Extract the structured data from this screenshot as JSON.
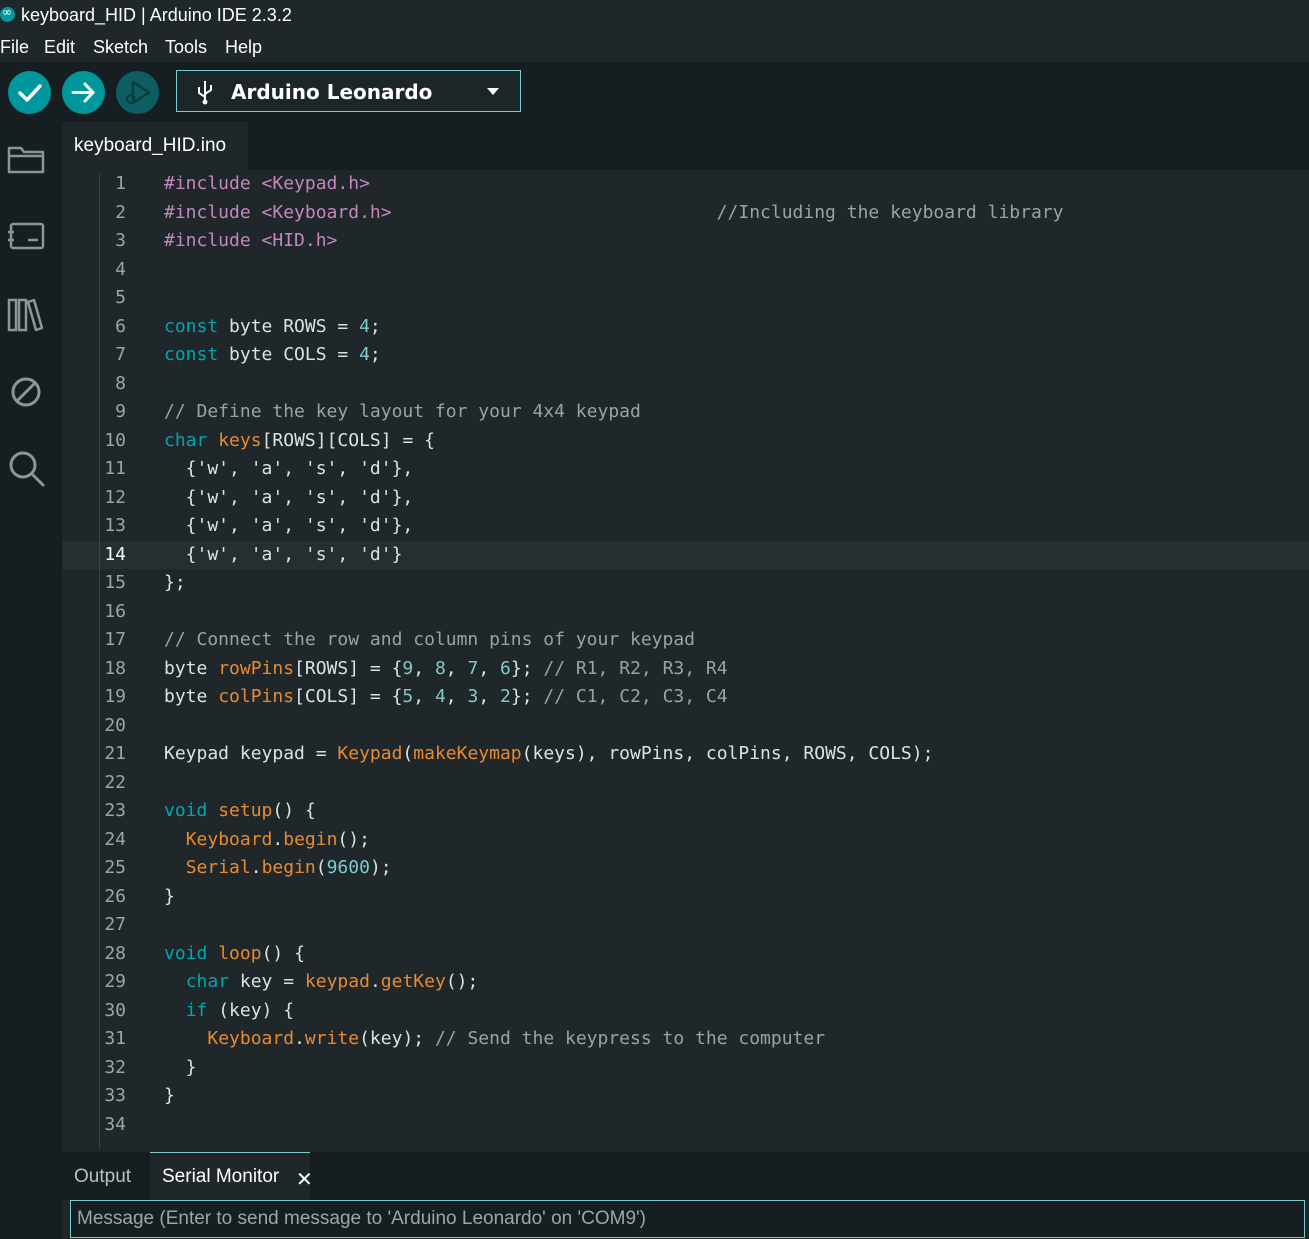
{
  "window": {
    "title": "keyboard_HID | Arduino IDE 2.3.2"
  },
  "menu": {
    "items": [
      "File",
      "Edit",
      "Sketch",
      "Tools",
      "Help"
    ]
  },
  "toolbar": {
    "board": "Arduino Leonardo"
  },
  "colors": {
    "accent": "#00979c",
    "keyword": "#00a7ad",
    "preprocessor": "#c586c0",
    "function": "#e98a31",
    "comment": "#95a5a6",
    "number": "#7fcbcd",
    "plain": "#dae3e3"
  },
  "sidebar": {
    "icons": [
      "folder-icon",
      "board-manager-icon",
      "library-icon",
      "debug-icon",
      "search-icon"
    ]
  },
  "editor": {
    "tab": "keyboard_HID.ino",
    "current_line": 14,
    "lines": [
      {
        "n": "1",
        "t": [
          [
            "pp",
            "#include <Keypad.h>"
          ]
        ]
      },
      {
        "n": "2",
        "t": [
          [
            "pp",
            "#include <Keyboard.h>"
          ],
          [
            "cm",
            "                              //Including the keyboard library"
          ]
        ]
      },
      {
        "n": "3",
        "t": [
          [
            "pp",
            "#include <HID.h>"
          ]
        ]
      },
      {
        "n": "4",
        "t": []
      },
      {
        "n": "5",
        "t": []
      },
      {
        "n": "6",
        "t": [
          [
            "kw",
            "const"
          ],
          [
            "pl",
            " byte ROWS = "
          ],
          [
            "nm",
            "4"
          ],
          [
            "pl",
            ";"
          ]
        ]
      },
      {
        "n": "7",
        "t": [
          [
            "kw",
            "const"
          ],
          [
            "pl",
            " byte COLS = "
          ],
          [
            "nm",
            "4"
          ],
          [
            "pl",
            ";"
          ]
        ]
      },
      {
        "n": "8",
        "t": []
      },
      {
        "n": "9",
        "t": [
          [
            "cm",
            "// Define the key layout for your 4x4 keypad"
          ]
        ]
      },
      {
        "n": "10",
        "t": [
          [
            "kw",
            "char"
          ],
          [
            "pl",
            " "
          ],
          [
            "fn",
            "keys"
          ],
          [
            "pl",
            "[ROWS][COLS] = {"
          ]
        ]
      },
      {
        "n": "11",
        "t": [
          [
            "pl",
            "  {'w', 'a', 's', 'd'},"
          ]
        ]
      },
      {
        "n": "12",
        "t": [
          [
            "pl",
            "  {'w', 'a', 's', 'd'},"
          ]
        ]
      },
      {
        "n": "13",
        "t": [
          [
            "pl",
            "  {'w', 'a', 's', 'd'},"
          ]
        ]
      },
      {
        "n": "14",
        "t": [
          [
            "pl",
            "  {'w', 'a', 's', 'd'}"
          ]
        ]
      },
      {
        "n": "15",
        "t": [
          [
            "pl",
            "};"
          ]
        ]
      },
      {
        "n": "16",
        "t": []
      },
      {
        "n": "17",
        "t": [
          [
            "cm",
            "// Connect the row and column pins of your keypad"
          ]
        ]
      },
      {
        "n": "18",
        "t": [
          [
            "pl",
            "byte "
          ],
          [
            "fn",
            "rowPins"
          ],
          [
            "pl",
            "[ROWS] = {"
          ],
          [
            "nm",
            "9"
          ],
          [
            "pl",
            ", "
          ],
          [
            "nm",
            "8"
          ],
          [
            "pl",
            ", "
          ],
          [
            "nm",
            "7"
          ],
          [
            "pl",
            ", "
          ],
          [
            "nm",
            "6"
          ],
          [
            "pl",
            "}; "
          ],
          [
            "cm",
            "// R1, R2, R3, R4"
          ]
        ]
      },
      {
        "n": "19",
        "t": [
          [
            "pl",
            "byte "
          ],
          [
            "fn",
            "colPins"
          ],
          [
            "pl",
            "[COLS] = {"
          ],
          [
            "nm",
            "5"
          ],
          [
            "pl",
            ", "
          ],
          [
            "nm",
            "4"
          ],
          [
            "pl",
            ", "
          ],
          [
            "nm",
            "3"
          ],
          [
            "pl",
            ", "
          ],
          [
            "nm",
            "2"
          ],
          [
            "pl",
            "}; "
          ],
          [
            "cm",
            "// C1, C2, C3, C4"
          ]
        ]
      },
      {
        "n": "20",
        "t": []
      },
      {
        "n": "21",
        "t": [
          [
            "pl",
            "Keypad keypad = "
          ],
          [
            "fn",
            "Keypad"
          ],
          [
            "pl",
            "("
          ],
          [
            "fn",
            "makeKeymap"
          ],
          [
            "pl",
            "(keys), rowPins, colPins, ROWS, COLS);"
          ]
        ]
      },
      {
        "n": "22",
        "t": []
      },
      {
        "n": "23",
        "t": [
          [
            "kw",
            "void"
          ],
          [
            "pl",
            " "
          ],
          [
            "fn",
            "setup"
          ],
          [
            "pl",
            "() {"
          ]
        ]
      },
      {
        "n": "24",
        "t": [
          [
            "pl",
            "  "
          ],
          [
            "fn",
            "Keyboard"
          ],
          [
            "pl",
            "."
          ],
          [
            "fn",
            "begin"
          ],
          [
            "pl",
            "();"
          ]
        ]
      },
      {
        "n": "25",
        "t": [
          [
            "pl",
            "  "
          ],
          [
            "fn",
            "Serial"
          ],
          [
            "pl",
            "."
          ],
          [
            "fn",
            "begin"
          ],
          [
            "pl",
            "("
          ],
          [
            "nm",
            "9600"
          ],
          [
            "pl",
            ");"
          ]
        ]
      },
      {
        "n": "26",
        "t": [
          [
            "pl",
            "}"
          ]
        ]
      },
      {
        "n": "27",
        "t": []
      },
      {
        "n": "28",
        "t": [
          [
            "kw",
            "void"
          ],
          [
            "pl",
            " "
          ],
          [
            "fn",
            "loop"
          ],
          [
            "pl",
            "() {"
          ]
        ]
      },
      {
        "n": "29",
        "t": [
          [
            "pl",
            "  "
          ],
          [
            "kw",
            "char"
          ],
          [
            "pl",
            " key = "
          ],
          [
            "fn",
            "keypad"
          ],
          [
            "pl",
            "."
          ],
          [
            "fn",
            "getKey"
          ],
          [
            "pl",
            "();"
          ]
        ]
      },
      {
        "n": "30",
        "t": [
          [
            "pl",
            "  "
          ],
          [
            "kw",
            "if"
          ],
          [
            "pl",
            " (key) {"
          ]
        ]
      },
      {
        "n": "31",
        "t": [
          [
            "pl",
            "    "
          ],
          [
            "fn",
            "Keyboard"
          ],
          [
            "pl",
            "."
          ],
          [
            "fn",
            "write"
          ],
          [
            "pl",
            "(key); "
          ],
          [
            "cm",
            "// Send the keypress to the computer"
          ]
        ]
      },
      {
        "n": "32",
        "t": [
          [
            "pl",
            "  }"
          ]
        ]
      },
      {
        "n": "33",
        "t": [
          [
            "pl",
            "}"
          ]
        ]
      },
      {
        "n": "34",
        "t": []
      }
    ]
  },
  "bottom": {
    "output_tab": "Output",
    "serial_tab": "Serial Monitor",
    "message_placeholder": "Message (Enter to send message to 'Arduino Leonardo' on 'COM9')"
  }
}
